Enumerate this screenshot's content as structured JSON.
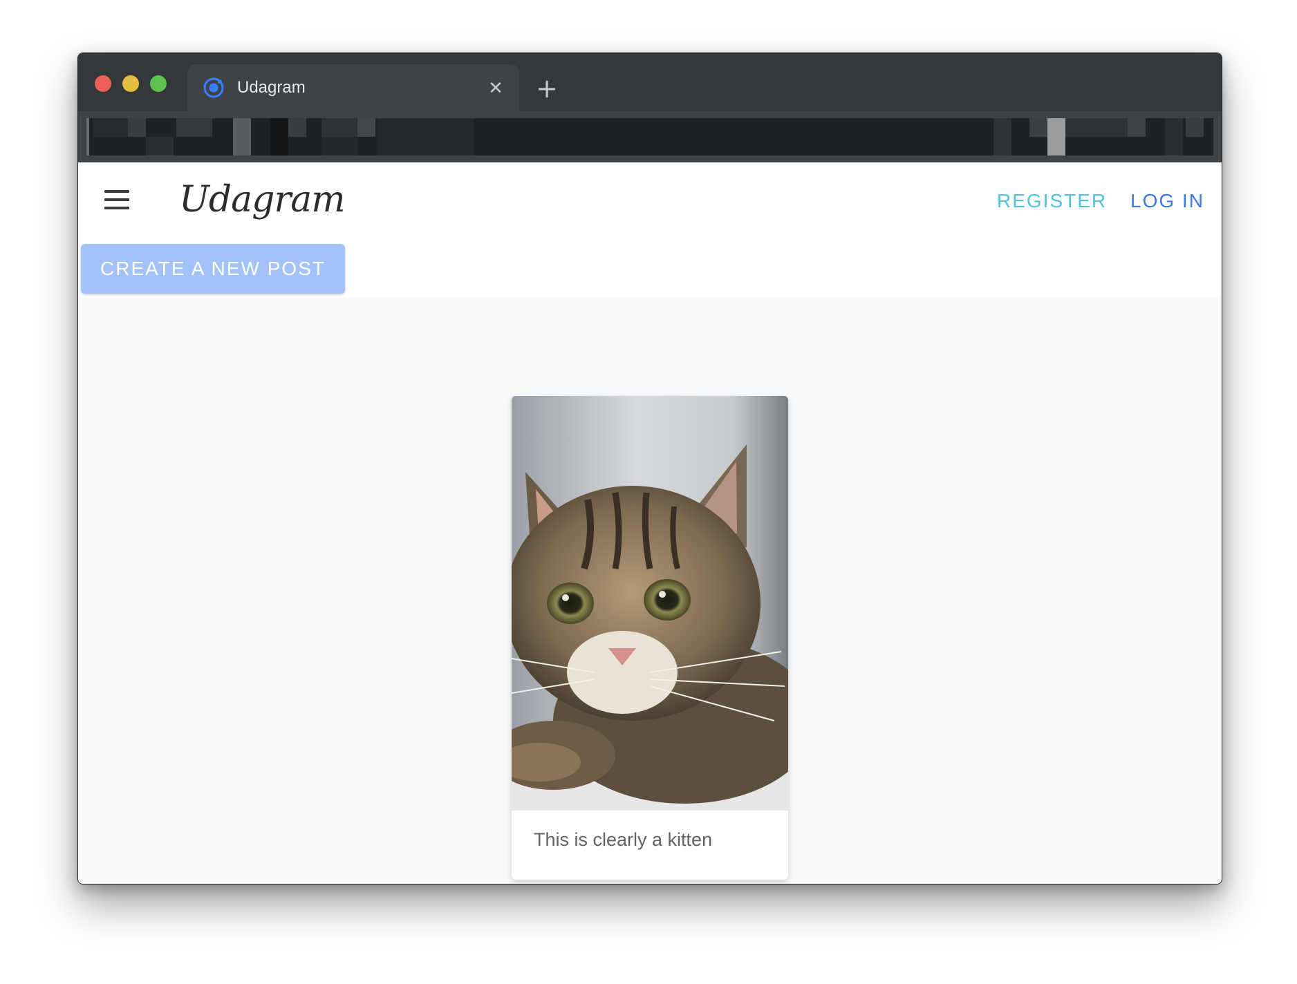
{
  "browser": {
    "tab_title": "Udagram",
    "tab_icon": "ionic-logo-icon",
    "close_symbol": "✕",
    "new_tab_symbol": "+"
  },
  "header": {
    "logo_text": "Udagram",
    "register_label": "REGISTER",
    "login_label": "LOG IN"
  },
  "actions": {
    "create_post_label": "CREATE A NEW POST"
  },
  "feed": {
    "items": [
      {
        "image_alt": "kitten photo",
        "caption": "This is clearly a kitten"
      }
    ]
  },
  "colors": {
    "register": "#4fc3d9",
    "login": "#3b78e7",
    "create_button": "#a4c2fa",
    "chrome_bg": "#35383b"
  }
}
